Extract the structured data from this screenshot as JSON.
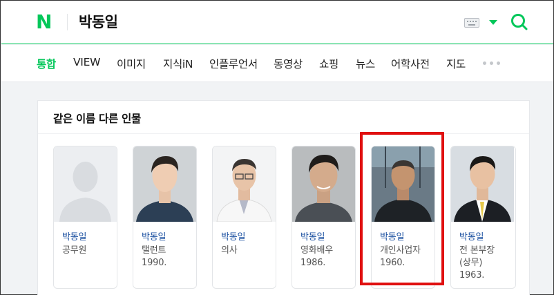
{
  "header": {
    "logo": "N",
    "query": "박동일",
    "brand_color": "#03c75a"
  },
  "tabs": [
    {
      "label": "통합",
      "active": true
    },
    {
      "label": "VIEW"
    },
    {
      "label": "이미지"
    },
    {
      "label": "지식iN"
    },
    {
      "label": "인플루언서"
    },
    {
      "label": "동영상"
    },
    {
      "label": "쇼핑"
    },
    {
      "label": "뉴스"
    },
    {
      "label": "어학사전"
    },
    {
      "label": "지도"
    }
  ],
  "section": {
    "title": "같은 이름 다른 인물",
    "people": [
      {
        "name": "박동일",
        "desc": "공무원"
      },
      {
        "name": "박동일",
        "desc": "탤런트\n1990."
      },
      {
        "name": "박동일",
        "desc": "의사"
      },
      {
        "name": "박동일",
        "desc": "영화배우\n1986."
      },
      {
        "name": "박동일",
        "desc": "개인사업자\n1960."
      },
      {
        "name": "박동일",
        "desc": "전 본부장\n(상무)\n1963."
      }
    ]
  }
}
